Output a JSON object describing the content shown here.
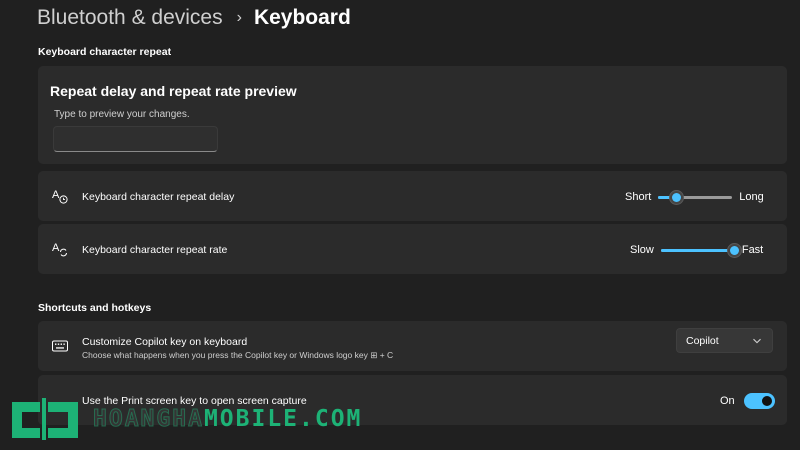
{
  "breadcrumb": {
    "parent": "Bluetooth & devices",
    "separator": "›",
    "current": "Keyboard"
  },
  "sections": {
    "repeat": "Keyboard character repeat",
    "shortcuts": "Shortcuts and hotkeys"
  },
  "preview": {
    "title": "Repeat delay and repeat rate preview",
    "hint": "Type to preview your changes.",
    "value": ""
  },
  "repeat_delay": {
    "label": "Keyboard character repeat delay",
    "min_label": "Short",
    "max_label": "Long",
    "level": 0.25,
    "icon": "keyboard-delay-icon"
  },
  "repeat_rate": {
    "label": "Keyboard character repeat rate",
    "min_label": "Slow",
    "max_label": "Fast",
    "level": 1.0,
    "icon": "keyboard-rate-icon"
  },
  "copilot": {
    "label": "Customize Copilot key on keyboard",
    "description": "Choose what happens when you press the Copilot key or Windows logo key ⊞ + C",
    "selected": "Copilot",
    "icon": "keyboard-icon"
  },
  "print_screen": {
    "label": "Use the Print screen key to open screen capture",
    "state_label": "On",
    "enabled": true
  },
  "watermark": {
    "part1": "HOANGHA",
    "part2": "MOBILE.COM"
  },
  "colors": {
    "accent": "#4cc2ff",
    "background": "#202020",
    "card": "#2b2b2b",
    "watermark": "#1db276"
  }
}
